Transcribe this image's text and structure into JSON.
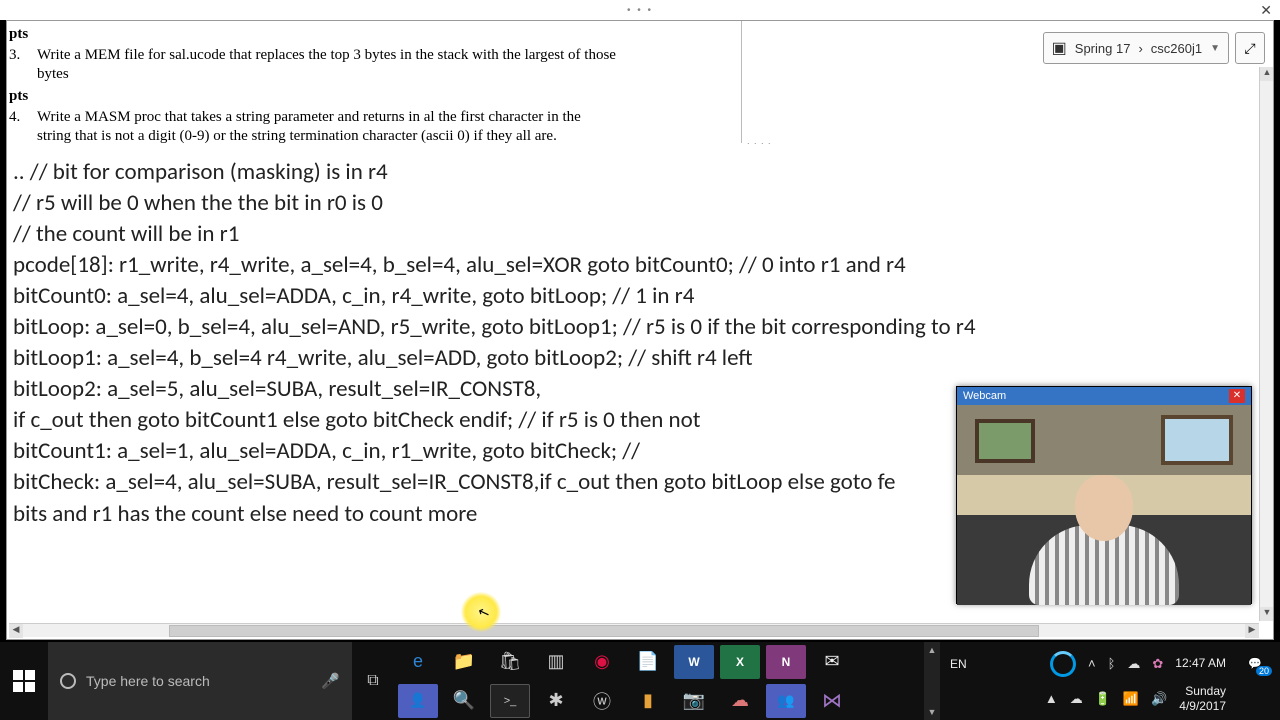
{
  "titlebar": {
    "dots": "• • •"
  },
  "breadcrumb": {
    "course": "Spring 17",
    "sep": "›",
    "page": "csc260j1"
  },
  "questions": {
    "pts3": "pts",
    "pts4": "pts",
    "num3": "3.",
    "num4": "4.",
    "q3": "Write a MEM file  for sal.ucode that replaces the top 3 bytes in the stack  with the largest of those bytes",
    "q4": "Write a MASM proc that takes a string parameter and returns in al the first character in the string that is not a digit (0-9) or the string termination character (ascii 0) if they all are."
  },
  "sep_dots": ". . . .",
  "code": {
    "l1": "..  // bit for comparison (masking) is in r4",
    "l2": "    // r5 will be 0 when the the bit in r0 is 0",
    "l3": "    // the count will be in r1",
    "l4": "pcode[18]: r1_write, r4_write, a_sel=4, b_sel=4, alu_sel=XOR goto bitCount0; // 0 into r1 and r4",
    "l5": " ",
    "l6": "bitCount0: a_sel=4, alu_sel=ADDA, c_in, r4_write, goto bitLoop;                                       // 1 in r4",
    "l7": "bitLoop:   a_sel=0, b_sel=4, alu_sel=AND, r5_write, goto bitLoop1;                                    // r5 is 0 if the bit corresponding to r4",
    "l8": "bitLoop1: a_sel=4, b_sel=4 r4_write, alu_sel=ADD, goto bitLoop2;                                     // shift r4 left",
    "l9": "bitLoop2: a_sel=5, alu_sel=SUBA, result_sel=IR_CONST8,",
    "l10": "          if c_out then goto bitCount1 else goto bitCheck endif;                     // if r5 is 0 then not",
    "l11": "bitCount1: a_sel=1, alu_sel=ADDA, c_in, r1_write, goto bitCheck;                                                     //",
    "l12": "bitCheck: a_sel=4, alu_sel=SUBA, result_sel=IR_CONST8,if c_out then goto bitLoop else goto fe",
    "l13": "bits and r1 has the count else need to count more"
  },
  "webcam": {
    "title": "Webcam"
  },
  "taskbar": {
    "search_placeholder": "Type here to search",
    "lang": "EN",
    "time": "12:47 AM",
    "day": "Sunday",
    "date": "4/9/2017",
    "badge": "20"
  },
  "icons": {
    "taskview": "⧉",
    "edge": "e",
    "folder": "📁",
    "store": "🛍",
    "filesx": "▥",
    "chrome": "◉",
    "note": "📄",
    "word": "W",
    "excel": "X",
    "onenote": "N",
    "mail": "✉",
    "teams": "👥",
    "magnify": "🔍",
    "cmd": ">_",
    "settings": "✱",
    "wp": "ⓦ",
    "lamp": "▮",
    "camera": "📷",
    "skype": "☁",
    "vs": "⋈",
    "peoplei": "👤",
    "up": "˄",
    "cloud": "☁",
    "onedrive": "▲",
    "pink": "✿",
    "bt": "ᛒ",
    "batt": "🔋",
    "wifi": "📶",
    "vol": "🔊",
    "chevron": "˄",
    "action": "💬"
  }
}
